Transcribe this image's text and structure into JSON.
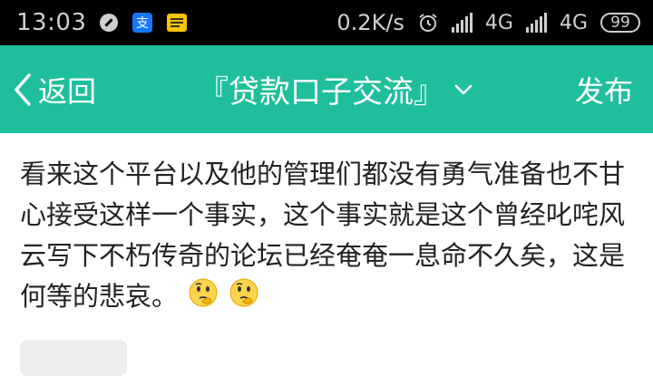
{
  "status_bar": {
    "time": "13:03",
    "speed": "0.2K/s",
    "network1": "4G",
    "network2": "4G",
    "battery": "99"
  },
  "navbar": {
    "back_label": "返回",
    "title": "『贷款口子交流』",
    "publish_label": "发布",
    "background_color": "#1fbf9c"
  },
  "post": {
    "text": "看来这个平台以及他的管理们都没有勇气准备也不甘心接受这样一个事实，这个事实就是这个曾经叱咤风云写下不朽传奇的论坛已经奄奄一息命不久矣，这是何等的悲哀。",
    "emojis": [
      "thinking-face-emoji",
      "thinking-face-emoji"
    ]
  }
}
